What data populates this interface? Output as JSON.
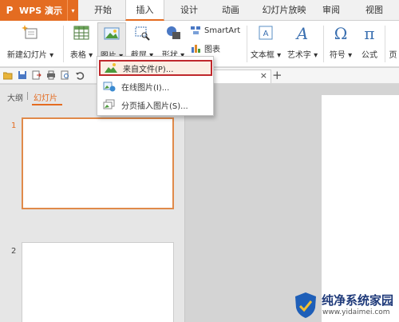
{
  "app": {
    "logo": "P",
    "title": "WPS 演示",
    "menu_caret": "▾"
  },
  "tabs": [
    {
      "label": "开始"
    },
    {
      "label": "插入"
    },
    {
      "label": "设计"
    },
    {
      "label": "动画"
    },
    {
      "label": "幻灯片放映"
    },
    {
      "label": "审阅"
    },
    {
      "label": "视图"
    }
  ],
  "ribbon": {
    "new_slide": "新建幻灯片 ▾",
    "table": "表格 ▾",
    "picture": "图片 ▾",
    "screenshot": "截屏 ▾",
    "shapes": "形状 ▾",
    "smartart": "SmartArt",
    "chart": "图表",
    "textbox": "文本框 ▾",
    "wordart": "艺术字 ▾",
    "symbol": "符号 ▾",
    "formula": "公式",
    "more": "页"
  },
  "quickbar": {
    "close": "×",
    "new_tab": "+"
  },
  "left_panel": {
    "tab_outline": "大纲",
    "tab_slides": "幻灯片",
    "slides": [
      {
        "number": "1"
      },
      {
        "number": "2"
      }
    ]
  },
  "dropdown": {
    "items": [
      {
        "label": "来自文件(P)..."
      },
      {
        "label": "在线图片(I)..."
      },
      {
        "label": "分页插入图片(S)..."
      }
    ]
  },
  "watermark": {
    "title": "纯净系统家园",
    "url": "www.yidaimei.com"
  },
  "colors": {
    "accent": "#e46c21",
    "highlight_border": "#c0282c"
  }
}
